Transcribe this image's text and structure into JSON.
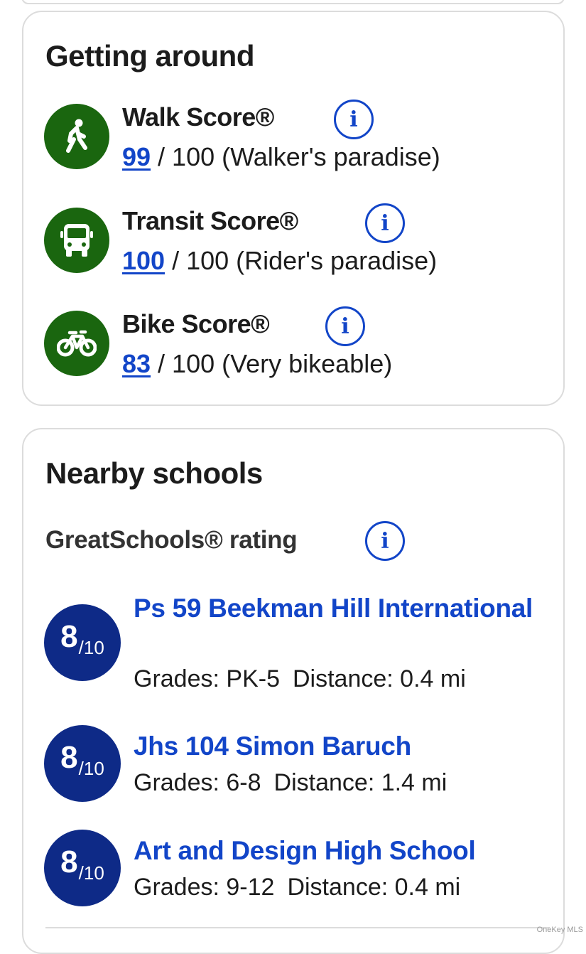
{
  "getting_around": {
    "title": "Getting around",
    "scores": [
      {
        "name": "Walk Score®",
        "value": "99",
        "rest": " / 100 (Walker's paradise)",
        "icon": "walk-icon"
      },
      {
        "name": "Transit Score®",
        "value": "100",
        "rest": " / 100 (Rider's paradise)",
        "icon": "bus-icon"
      },
      {
        "name": "Bike Score®",
        "value": "83",
        "rest": " / 100 (Very bikeable)",
        "icon": "bike-icon"
      }
    ],
    "info_glyph": "i"
  },
  "schools": {
    "title": "Nearby schools",
    "rating_label": "GreatSchools® rating",
    "items": [
      {
        "rating": "8",
        "rating_den": "/10",
        "name": "Ps 59 Beekman Hill International",
        "grades": "Grades: PK-5",
        "distance": "Distance: 0.4 mi"
      },
      {
        "rating": "8",
        "rating_den": "/10",
        "name": "Jhs 104 Simon Baruch",
        "grades": "Grades: 6-8",
        "distance": "Distance: 1.4 mi"
      },
      {
        "rating": "8",
        "rating_den": "/10",
        "name": "Art and Design High School",
        "grades": "Grades: 9-12",
        "distance": "Distance: 0.4 mi"
      }
    ]
  },
  "watermark": "OneKey MLS",
  "colors": {
    "score_icon_bg": "#1a660f",
    "link_blue": "#1245c8",
    "rating_badge": "#0e2a87",
    "border": "#dcdcdc"
  }
}
